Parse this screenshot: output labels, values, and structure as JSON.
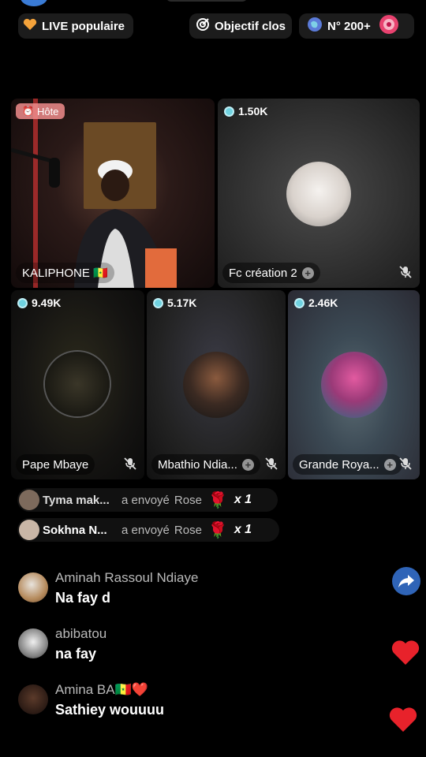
{
  "top_badges": {
    "live": "LIVE populaire",
    "goal": "Objectif clos",
    "rank": "N° 200+"
  },
  "tiles": {
    "host": {
      "tag": "Hôte",
      "name": "KALIPHONE 🇸🇳"
    },
    "fc": {
      "viewers": "1.50K",
      "name": "Fc création 2"
    },
    "pape": {
      "viewers": "9.49K",
      "name": "Pape Mbaye"
    },
    "mbathio": {
      "viewers": "5.17K",
      "name": "Mbathio  Ndia..."
    },
    "grande": {
      "viewers": "2.46K",
      "name": "Grande Roya..."
    }
  },
  "gifts": [
    {
      "user": "Tyma mak...",
      "action": "a envoyé",
      "gift": "Rose",
      "count": "x 1"
    },
    {
      "user": "Sokhna N...",
      "action": "a envoyé",
      "gift": "Rose",
      "count": "x 1"
    }
  ],
  "comments": [
    {
      "user": "Aminah Rassoul Ndiaye",
      "text": "Na fay d"
    },
    {
      "user": "abibatou",
      "text": "na fay"
    },
    {
      "user": "Amina BA🇸🇳❤️",
      "text": "Sathiey wouuuu"
    }
  ],
  "colors": {
    "background": "#000000",
    "viewer_icon": "#6fd2e0",
    "host_tag": "#f08c8c",
    "share": "#2f64b7",
    "heart": "#e8222b"
  }
}
